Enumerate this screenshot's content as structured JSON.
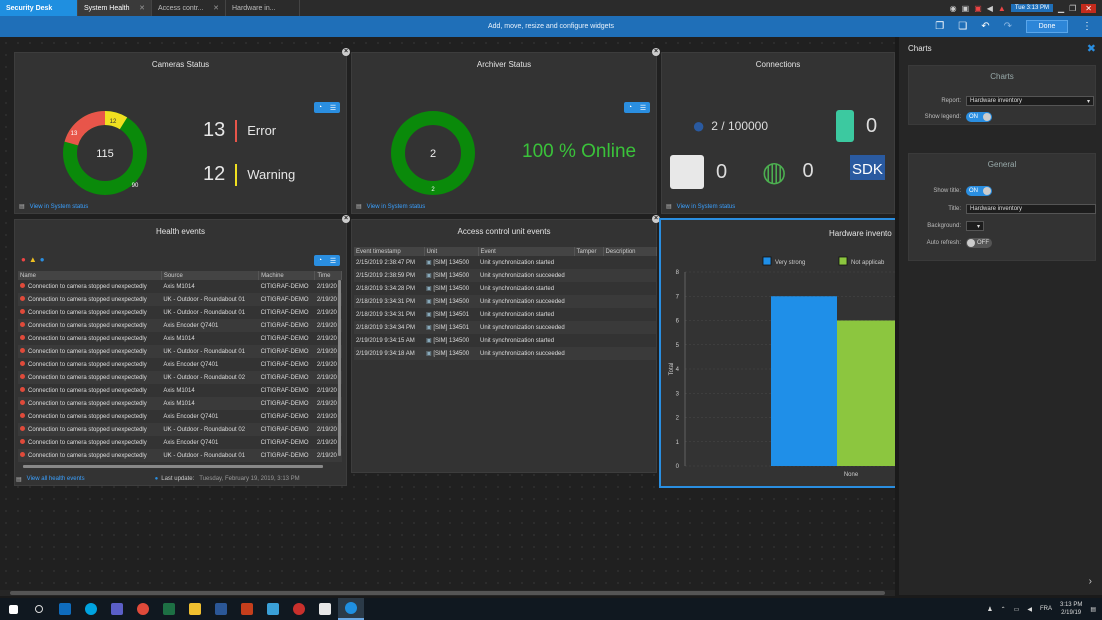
{
  "tabs": [
    {
      "label": "Security Desk",
      "kind": "home"
    },
    {
      "label": "System Health",
      "kind": "active"
    },
    {
      "label": "Access contr...",
      "kind": ""
    },
    {
      "label": "Hardware in...",
      "kind": ""
    }
  ],
  "clock_top": "Tue 3:13 PM",
  "banner": "Add, move, resize and configure widgets",
  "done_label": "Done",
  "widgets": {
    "cameras": {
      "title": "Cameras Status",
      "total": "115",
      "seg_error": "13",
      "seg_warning": "12",
      "seg_ok": "90",
      "error_count": "13",
      "error_label": "Error",
      "warning_count": "12",
      "warning_label": "Warning",
      "link": "View in System status",
      "ok_value": 90,
      "error_value": 13,
      "warning_value": 12
    },
    "archiver": {
      "title": "Archiver Status",
      "total": "2",
      "seg_ok": "2",
      "online": "100 % Online",
      "link": "View in System status"
    },
    "connections": {
      "title": "Connections",
      "users": "2 / 100000",
      "mobile": "0",
      "workstations": "0",
      "web": "0",
      "sdk_label": "SDK",
      "link": "View in System status"
    },
    "health": {
      "title": "Health events",
      "columns": [
        "Name",
        "Source",
        "Machine",
        "Time"
      ],
      "rows": [
        [
          "Connection to camera stopped unexpectedly",
          "Axis M1014",
          "CITIGRAF-DEMO",
          "2/19/20"
        ],
        [
          "Connection to camera stopped unexpectedly",
          "UK - Outdoor - Roundabout 01",
          "CITIGRAF-DEMO",
          "2/19/20"
        ],
        [
          "Connection to camera stopped unexpectedly",
          "UK - Outdoor - Roundabout 01",
          "CITIGRAF-DEMO",
          "2/19/20"
        ],
        [
          "Connection to camera stopped unexpectedly",
          "Axis Encoder Q7401",
          "CITIGRAF-DEMO",
          "2/19/20"
        ],
        [
          "Connection to camera stopped unexpectedly",
          "Axis M1014",
          "CITIGRAF-DEMO",
          "2/19/20"
        ],
        [
          "Connection to camera stopped unexpectedly",
          "UK - Outdoor - Roundabout 01",
          "CITIGRAF-DEMO",
          "2/19/20"
        ],
        [
          "Connection to camera stopped unexpectedly",
          "Axis Encoder Q7401",
          "CITIGRAF-DEMO",
          "2/19/20"
        ],
        [
          "Connection to camera stopped unexpectedly",
          "UK - Outdoor - Roundabout 02",
          "CITIGRAF-DEMO",
          "2/19/20"
        ],
        [
          "Connection to camera stopped unexpectedly",
          "Axis M1014",
          "CITIGRAF-DEMO",
          "2/19/20"
        ],
        [
          "Connection to camera stopped unexpectedly",
          "Axis M1014",
          "CITIGRAF-DEMO",
          "2/19/20"
        ],
        [
          "Connection to camera stopped unexpectedly",
          "Axis Encoder Q7401",
          "CITIGRAF-DEMO",
          "2/19/20"
        ],
        [
          "Connection to camera stopped unexpectedly",
          "UK - Outdoor - Roundabout 02",
          "CITIGRAF-DEMO",
          "2/19/20"
        ],
        [
          "Connection to camera stopped unexpectedly",
          "Axis Encoder Q7401",
          "CITIGRAF-DEMO",
          "2/19/20"
        ],
        [
          "Connection to camera stopped unexpectedly",
          "UK - Outdoor - Roundabout 01",
          "CITIGRAF-DEMO",
          "2/19/20"
        ]
      ],
      "link": "View all health events",
      "last_update": "Last update:",
      "last_update_value": "Tuesday, February 19, 2019, 3:13 PM"
    },
    "access": {
      "title": "Access control unit events",
      "columns": [
        "Event timestamp",
        "Unit",
        "Event",
        "Tamper",
        "Description"
      ],
      "rows": [
        [
          "2/15/2019 2:38:47 PM",
          "[SIM] 134500",
          "Unit synchronization started"
        ],
        [
          "2/15/2019 2:38:59 PM",
          "[SIM] 134500",
          "Unit synchronization succeeded"
        ],
        [
          "2/18/2019 3:34:28 PM",
          "[SIM] 134500",
          "Unit synchronization started"
        ],
        [
          "2/18/2019 3:34:31 PM",
          "[SIM] 134500",
          "Unit synchronization succeeded"
        ],
        [
          "2/18/2019 3:34:31 PM",
          "[SIM] 134501",
          "Unit synchronization started"
        ],
        [
          "2/18/2019 3:34:34 PM",
          "[SIM] 134501",
          "Unit synchronization succeeded"
        ],
        [
          "2/19/2019 9:34:15 AM",
          "[SIM] 134500",
          "Unit synchronization started"
        ],
        [
          "2/19/2019 9:34:18 AM",
          "[SIM] 134500",
          "Unit synchronization succeeded"
        ]
      ]
    },
    "hardware": {
      "title": "Hardware invento"
    }
  },
  "chart_data": {
    "type": "bar",
    "categories": [
      "None"
    ],
    "series": [
      {
        "name": "Very strong",
        "values": [
          7
        ],
        "color": "#1f8fe8"
      },
      {
        "name": "Not applicab",
        "values": [
          6
        ],
        "color": "#8cc63f"
      }
    ],
    "ylabel": "Total",
    "ylim": [
      0,
      8
    ],
    "yticks": [
      "0",
      "1",
      "2",
      "3",
      "4",
      "5",
      "6",
      "7",
      "8"
    ],
    "legend_position": "top"
  },
  "panel": {
    "title": "Charts",
    "charts_group": "Charts",
    "report_label": "Report:",
    "report_value": "Hardware inventory",
    "legend_label": "Show legend:",
    "legend_state": "ON",
    "general_group": "General",
    "show_title_label": "Show title:",
    "show_title_state": "ON",
    "title_label": "Title:",
    "title_value": "Hardware inventory",
    "background_label": "Background:",
    "refresh_label": "Auto refresh:",
    "refresh_state": "OFF"
  },
  "taskbar": {
    "lang": "FRA",
    "time": "3:13 PM",
    "date": "2/19/19"
  }
}
